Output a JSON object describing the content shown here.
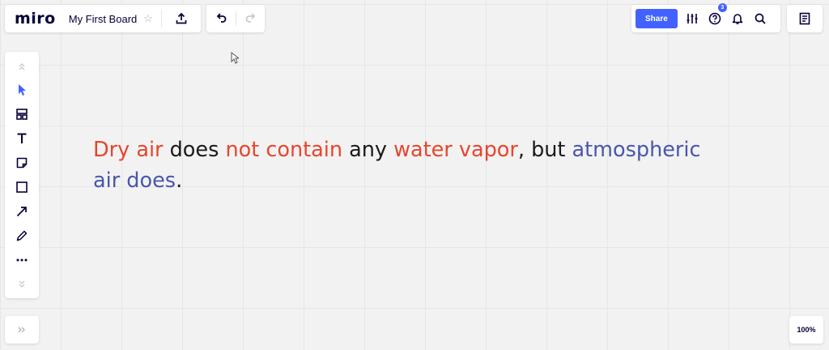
{
  "header": {
    "logo": "miro",
    "board_name": "My First Board",
    "star_icon": "star-icon",
    "upload_icon": "upload-icon",
    "undo_icon": "undo-icon",
    "redo_icon": "redo-icon"
  },
  "right_header": {
    "share_label": "Share",
    "settings_icon": "sliders-icon",
    "help_icon": "help-icon",
    "help_badge": "3",
    "bell_icon": "bell-icon",
    "search_icon": "search-icon",
    "notes_icon": "notes-icon"
  },
  "toolbar": {
    "tools": [
      "collapse-up-icon",
      "select-cursor-icon",
      "templates-icon",
      "text-icon",
      "sticky-note-icon",
      "shape-icon",
      "arrow-icon",
      "pen-icon",
      "more-icon",
      "collapse-down-icon"
    ]
  },
  "canvas_text": {
    "s1": "Dry air",
    "s2": " does ",
    "s3": "not contain",
    "s4": " any ",
    "s5": "water vapor",
    "s6": ", but ",
    "s7": "atmospheric air does",
    "s8": "."
  },
  "footer": {
    "expand_icon": "double-chevron-right-icon",
    "zoom": "100%"
  },
  "colors": {
    "accent": "#4262ff",
    "red_text": "#e8452c",
    "blue_text": "#4a56ad",
    "background": "#f2f2f2"
  }
}
